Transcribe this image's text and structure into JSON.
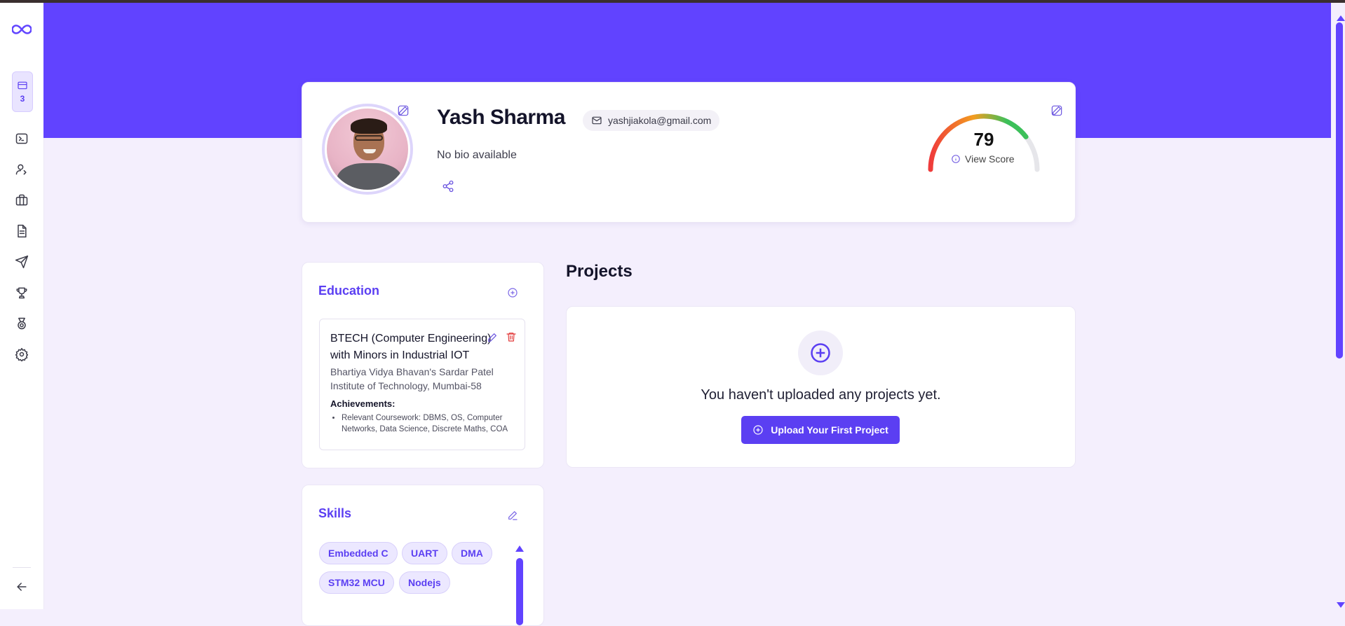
{
  "sidebar": {
    "counter": "3",
    "items": [
      {
        "icon": "terminal-icon"
      },
      {
        "icon": "user-edit-icon"
      },
      {
        "icon": "briefcase-icon"
      },
      {
        "icon": "document-icon"
      },
      {
        "icon": "send-icon"
      },
      {
        "icon": "trophy-icon"
      },
      {
        "icon": "medal-icon"
      },
      {
        "icon": "settings-icon"
      }
    ],
    "collapse_icon": "arrow-left-icon"
  },
  "profile": {
    "name": "Yash Sharma",
    "email": "yashjiakola@gmail.com",
    "bio": "No bio available",
    "score": "79",
    "score_fraction": 0.79,
    "view_score_label": "View Score",
    "colors": {
      "banner": "#6143ff",
      "accent": "#5b3ff2"
    }
  },
  "education": {
    "title": "Education",
    "items": [
      {
        "degree": "BTECH (Computer Engineering) with Minors in Industrial IOT",
        "institute": "Bhartiya Vidya Bhavan's Sardar Patel Institute of Technology, Mumbai-58",
        "achievements_label": "Achievements:",
        "achievements": [
          "Relevant Coursework: DBMS, OS, Computer Networks, Data Science, Discrete Maths, COA"
        ]
      }
    ]
  },
  "skills": {
    "title": "Skills",
    "items": [
      "Embedded C",
      "UART",
      "DMA",
      "STM32 MCU",
      "Nodejs"
    ]
  },
  "projects": {
    "title": "Projects",
    "empty_message": "You haven't uploaded any projects yet.",
    "upload_button": "Upload Your First Project"
  }
}
